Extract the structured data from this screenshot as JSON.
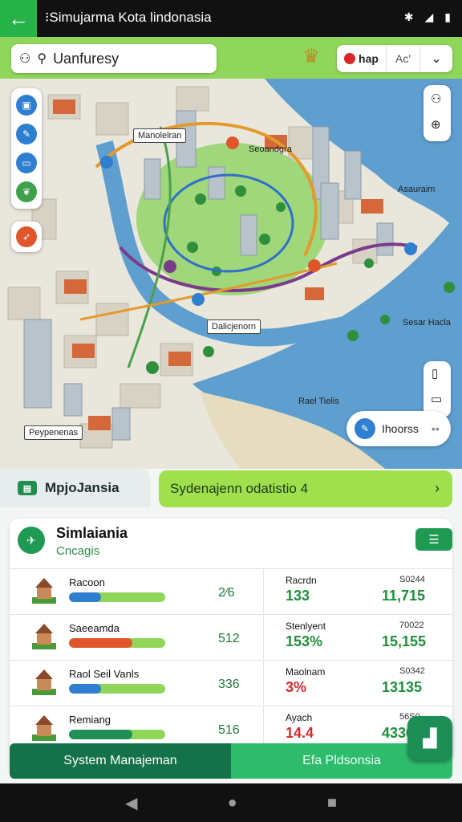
{
  "app": {
    "title": "Simujarma Kota lindonasia",
    "back_icon": "arrow-left-icon"
  },
  "search": {
    "value": "Uanfuresy",
    "icons": [
      "user-icon",
      "search-icon"
    ]
  },
  "header_pill": {
    "label_a": "hap",
    "label_b": "Ac'",
    "dropdown_icon": "chevron-down-icon"
  },
  "map": {
    "labels": {
      "label1": "Manolelran",
      "label2": "Seoandgra",
      "label3": "Asauraim",
      "label4": "Sesar Hacla",
      "label5": "Dalicjenorn",
      "label6": "Rael Tielis",
      "label7": "Peypenenas"
    },
    "callout": "Ihoorss",
    "callout_more": "••"
  },
  "panel": {
    "tab_label": "MpjoJansia",
    "banner_text": "Sydenajenn odatistio 4",
    "card_title": "Simlaiania",
    "card_subtitle": "Cncagis",
    "rows": [
      {
        "name": "Racoon",
        "pct": "2⁄6",
        "bar_color": "#2f7fd0",
        "fill": 0.33,
        "stat_label": "Racrdn",
        "stat_val": "133",
        "stat_color": "#1f8f3a",
        "small": "S0244",
        "big": "11,715"
      },
      {
        "name": "Saeeamda",
        "pct": "512",
        "bar_color": "#e0562b",
        "fill": 0.66,
        "stat_label": "Stenlyent",
        "stat_val": "153%",
        "stat_color": "#1f8f3a",
        "small": "70022",
        "big": "15,155"
      },
      {
        "name": "Raol Seil Vanls",
        "pct": "336",
        "bar_color": "#2f7fd0",
        "fill": 0.33,
        "stat_label": "Maolnam",
        "stat_val": "3%",
        "stat_color": "#d62b2b",
        "small": "S0342",
        "big": "13135"
      },
      {
        "name": "Remiang",
        "pct": "516",
        "bar_color": "#1f8f56",
        "fill": 0.66,
        "stat_label": "Ayach",
        "stat_val": "14.4",
        "stat_color": "#d62b2b",
        "small": "56S0",
        "big": "4336"
      }
    ],
    "btn_left": "System Manajeman",
    "btn_right": "Efa Pldsonsia"
  }
}
